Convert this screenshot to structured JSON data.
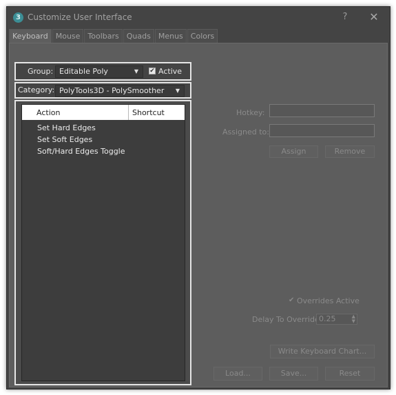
{
  "window": {
    "title": "Customize User Interface",
    "app_icon": "3",
    "help": "?",
    "close": "✕"
  },
  "tabs": [
    "Keyboard",
    "Mouse",
    "Toolbars",
    "Quads",
    "Menus",
    "Colors"
  ],
  "group": {
    "label": "Group:",
    "value": "Editable Poly",
    "active_label": "Active",
    "active_checked": true
  },
  "category": {
    "label": "Category:",
    "value": "PolyTools3D - PolySmoother"
  },
  "list": {
    "col_action": "Action",
    "col_shortcut": "Shortcut",
    "items": [
      "Set Hard Edges",
      "Set Soft Edges",
      "Soft/Hard Edges Toggle"
    ]
  },
  "hotkey": {
    "label": "Hotkey:",
    "value": ""
  },
  "assigned": {
    "label": "Assigned to:",
    "value": ""
  },
  "buttons": {
    "assign": "Assign",
    "remove": "Remove",
    "write_chart": "Write Keyboard Chart...",
    "load": "Load...",
    "save": "Save...",
    "reset": "Reset"
  },
  "overrides": {
    "label": "Overrides Active",
    "checked": true
  },
  "delay": {
    "label": "Delay To Override:",
    "value": "0.25"
  }
}
